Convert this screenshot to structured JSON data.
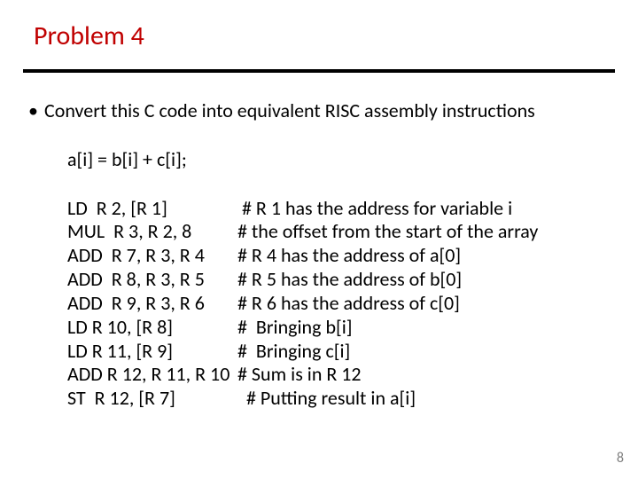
{
  "title": "Problem 4",
  "bullet": "Convert this C code into equivalent RISC assembly instructions",
  "code": "a[i] = b[i] + c[i];",
  "asm": [
    {
      "instr": "LD  R 2, [R 1]",
      "comment": " # R 1 has the address for variable i"
    },
    {
      "instr": "MUL  R 3, R 2, 8",
      "comment": "# the offset from the start of the array"
    },
    {
      "instr": "ADD  R 7, R 3, R 4",
      "comment": "# R 4 has the address of a[0]"
    },
    {
      "instr": "ADD  R 8, R 3, R 5",
      "comment": "# R 5 has the address of b[0]"
    },
    {
      "instr": "ADD  R 9, R 3, R 6",
      "comment": "# R 6 has the address of c[0]"
    },
    {
      "instr": "LD R 10, [R 8]",
      "comment": "#  Bringing b[i]"
    },
    {
      "instr": "LD R 11, [R 9]",
      "comment": "#  Bringing c[i]"
    },
    {
      "instr": "ADD R 12, R 11, R 10",
      "comment": "# Sum is in R 12"
    },
    {
      "instr": "ST  R 12, [R 7]",
      "comment": "  # Putting result in a[i]"
    }
  ],
  "page": "8"
}
